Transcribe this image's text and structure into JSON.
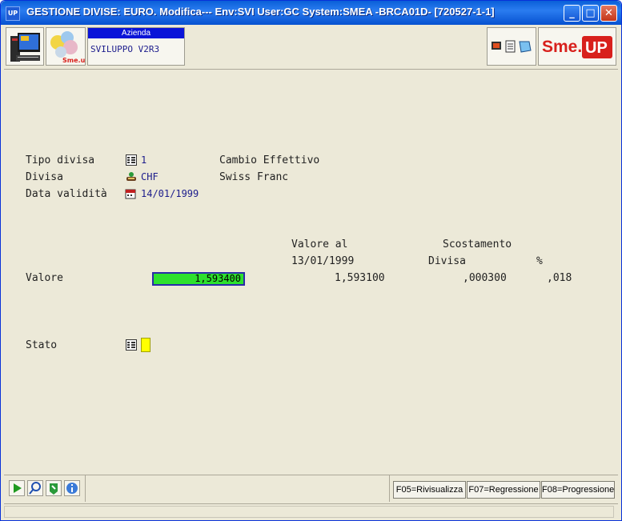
{
  "window": {
    "app_icon": "UP",
    "title": "GESTIONE DIVISE: EURO.  Modifica---  Env:SVI User:GC System:SMEA -BRCA01D- [720527-1-1]",
    "minimize": "_",
    "maximize": "□",
    "close": "✕"
  },
  "toolbar": {
    "azienda_label": "Azienda",
    "azienda_value": "SVILUPPO V2R3",
    "smeup_logo_small": "Sme.up",
    "brand_logo": "Sme.UP",
    "brand_color": "#d8201c"
  },
  "form": {
    "tipo_divisa": {
      "label": "Tipo divisa",
      "code": "1",
      "description": "Cambio Effettivo",
      "icon": "list-icon"
    },
    "divisa": {
      "label": "Divisa",
      "code": "CHF",
      "description": "Swiss Franc",
      "icon": "currency-icon"
    },
    "data_validita": {
      "label": "Data validità",
      "value": "14/01/1999",
      "icon": "calendar-icon"
    },
    "header_valore_al": "Valore al",
    "header_scostamento": "Scostamento",
    "header_date": "13/01/1999",
    "header_divisa": "Divisa",
    "header_percent": "%",
    "valore": {
      "label": "Valore",
      "input_value": "1,593400",
      "valore_al": "1,593100",
      "scostamento_divisa": ",000300",
      "scostamento_percent": ",018"
    },
    "stato": {
      "label": "Stato",
      "value": ""
    }
  },
  "function_keys": [
    {
      "label": "F05=Rivisualizza"
    },
    {
      "label": "F07=Regressione"
    },
    {
      "label": "F08=Progressione"
    }
  ],
  "nav_icons": [
    "play-icon",
    "search-icon",
    "export-icon",
    "info-icon"
  ]
}
